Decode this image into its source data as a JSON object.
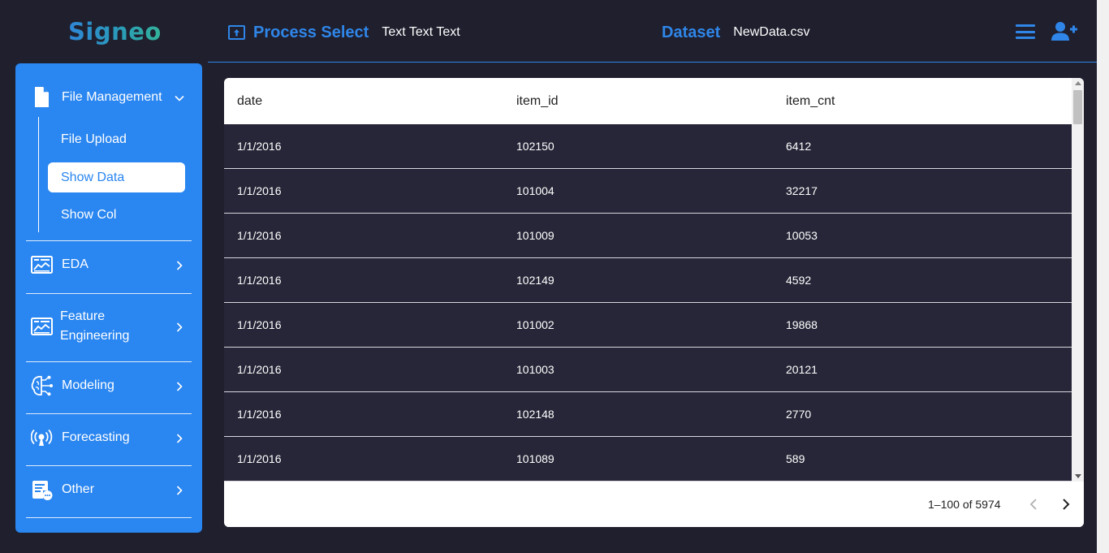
{
  "app": {
    "logo": "Signeo"
  },
  "header": {
    "process_title": "Process Select",
    "process_text": "Text Text Text",
    "dataset_title": "Dataset",
    "dataset_file": "NewData.csv",
    "icons": [
      "upload-icon",
      "hamburger-menu-icon",
      "add-user-icon"
    ]
  },
  "sidebar": {
    "file_management": {
      "label": "File Management",
      "icon": "file-icon",
      "expanded": true,
      "items": [
        {
          "label": "File Upload",
          "active": false
        },
        {
          "label": "Show Data",
          "active": true
        },
        {
          "label": "Show Col",
          "active": false
        }
      ]
    },
    "sections": [
      {
        "label": "EDA",
        "icon": "chart-panel-icon"
      },
      {
        "label": "Feature Engineering",
        "label_line1": "Feature",
        "label_line2": "Engineering",
        "icon": "chart-panel-icon"
      },
      {
        "label": "Modeling",
        "icon": "brain-circuit-icon"
      },
      {
        "label": "Forecasting",
        "icon": "broadcast-icon"
      },
      {
        "label": "Other",
        "icon": "document-chat-icon"
      }
    ]
  },
  "table": {
    "columns": [
      "date",
      "item_id",
      "item_cnt"
    ],
    "rows": [
      [
        "1/1/2016",
        "102150",
        "6412"
      ],
      [
        "1/1/2016",
        "101004",
        "32217"
      ],
      [
        "1/1/2016",
        "101009",
        "10053"
      ],
      [
        "1/1/2016",
        "102149",
        "4592"
      ],
      [
        "1/1/2016",
        "101002",
        "19868"
      ],
      [
        "1/1/2016",
        "101003",
        "20121"
      ],
      [
        "1/1/2016",
        "102148",
        "2770"
      ],
      [
        "1/1/2016",
        "101089",
        "589"
      ]
    ],
    "pagination": "1–100 of 5974"
  },
  "colors": {
    "background": "#1f1f2e",
    "accent": "#2f86e8",
    "sidebar": "#2a86f0",
    "table_body": "#262638"
  }
}
